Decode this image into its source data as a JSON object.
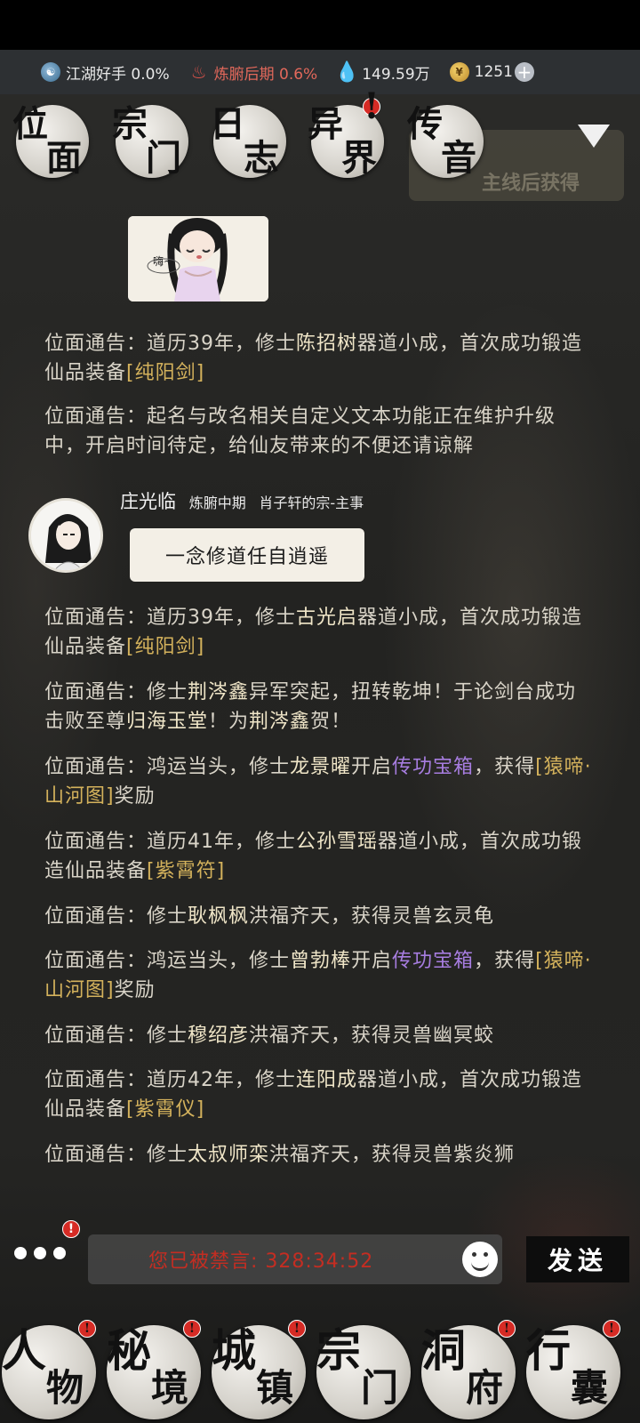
{
  "resources": [
    {
      "icon": "globe-icon",
      "label": "江湖好手 0.0%"
    },
    {
      "icon": "flame-icon",
      "label": "炼腑后期 0.6%"
    },
    {
      "icon": "water-drop-icon",
      "label": "149.59万"
    },
    {
      "icon": "coin-icon",
      "label": "1251"
    }
  ],
  "top_tabs": [
    {
      "c1": "位",
      "c2": "面"
    },
    {
      "c1": "宗",
      "c2": "门"
    },
    {
      "c1": "日",
      "c2": "志"
    },
    {
      "c1": "异",
      "c2": "界",
      "badge": "!"
    },
    {
      "c1": "传",
      "c2": "音"
    }
  ],
  "banner_text": "主线后获得",
  "image_caption": "嗨~",
  "messages": [
    {
      "prefix": "位面通告：道历39年，修士",
      "name": "陈招树",
      "mid": "器道小成，首次成功锻造仙品装备",
      "item": "[纯阳剑]"
    },
    {
      "text": "位面通告：起名与改名相关自定义文本功能正在维护升级中，开启时间待定，给仙友带来的不便还请谅解"
    },
    {
      "prefix": "位面通告：道历39年，修士",
      "name": "古光启",
      "mid": "器道小成，首次成功锻造仙品装备",
      "item": "[纯阳剑]"
    },
    {
      "prefix": "位面通告：修士",
      "name": "荆涔鑫",
      "mid": "异军突起，扭转乾坤！于论剑台成功击败至尊",
      "name2": "归海玉堂",
      "mid2": "！为",
      "name3": "荆涔鑫",
      "end": "贺！"
    },
    {
      "prefix": "位面通告：鸿运当头，修士",
      "name": "龙景曜",
      "mid": "开启",
      "purple": "传功宝箱",
      "mid2": "，获得",
      "item": "[猿啼·山河图]",
      "end": "奖励"
    },
    {
      "prefix": "位面通告：道历41年，修士",
      "name": "公孙雪瑶",
      "mid": "器道小成，首次成功锻造仙品装备",
      "item": "[紫霄符]"
    },
    {
      "prefix": "位面通告：修士",
      "name": "耿枫枫",
      "mid": "洪福齐天，获得灵兽玄灵龟"
    },
    {
      "prefix": "位面通告：鸿运当头，修士",
      "name": "曾勃棒",
      "mid": "开启",
      "purple": "传功宝箱",
      "mid2": "，获得",
      "item": "[猿啼·山河图]",
      "end": "奖励"
    },
    {
      "prefix": "位面通告：修士",
      "name": "穆绍彦",
      "mid": "洪福齐天，获得灵兽幽冥蛟"
    },
    {
      "prefix": "位面通告：道历42年，修士",
      "name": "连阳成",
      "mid": "器道小成，首次成功锻造仙品装备",
      "item": "[紫霄仪]"
    },
    {
      "prefix": "位面通告：修士",
      "name": "太叔师栾",
      "mid": "洪福齐天，获得灵兽紫炎狮"
    }
  ],
  "player_message": {
    "name": "庄光临",
    "realm": "炼腑中期",
    "sect": "肖子轩的宗-主事",
    "text": "一念修道任自逍遥"
  },
  "input": {
    "muted_text": "您已被禁言: 328:34:52"
  },
  "send_label": "发送",
  "bottom_nav": [
    {
      "c1": "人",
      "c2": "物",
      "badge": "!"
    },
    {
      "c1": "秘",
      "c2": "境",
      "badge": "!"
    },
    {
      "c1": "城",
      "c2": "镇",
      "badge": "!"
    },
    {
      "c1": "宗",
      "c2": "门"
    },
    {
      "c1": "洞",
      "c2": "府",
      "badge": "!"
    },
    {
      "c1": "行",
      "c2": "囊",
      "badge": "!"
    }
  ]
}
